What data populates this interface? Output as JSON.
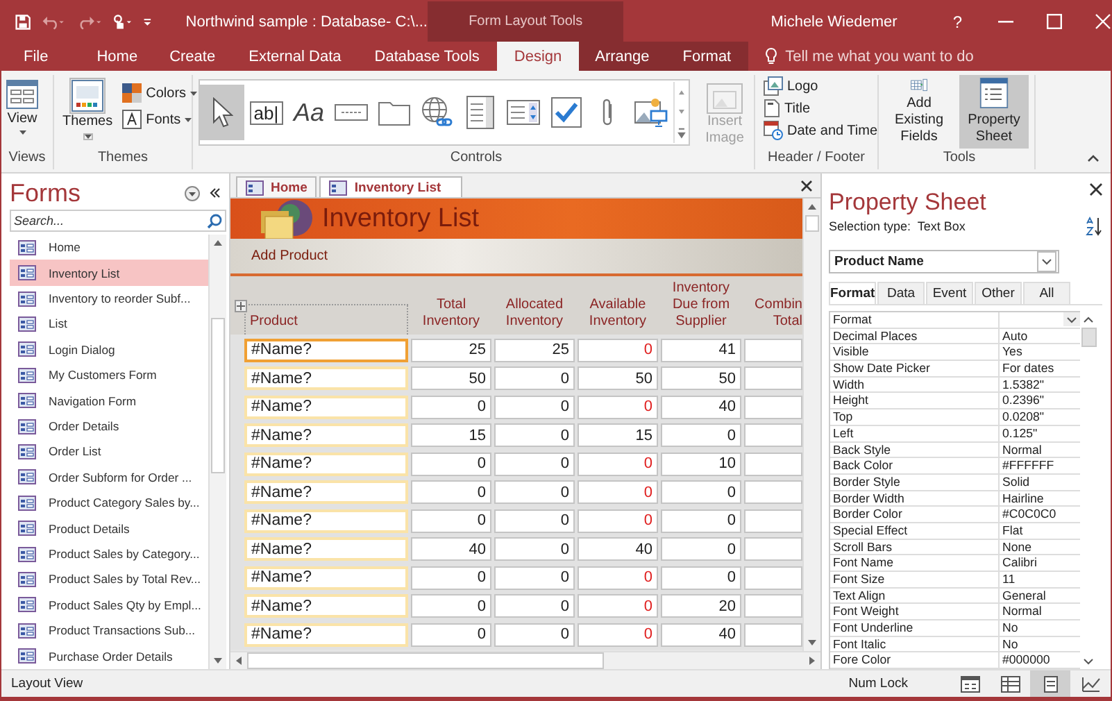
{
  "title_bar": {
    "title": "Northwind sample : Database- C:\\...",
    "context_label": "Form Layout Tools",
    "user": "Michele Wiedemer",
    "help": "?"
  },
  "ribbon_tabs": [
    {
      "label": "File",
      "selected": false,
      "contextual": false
    },
    {
      "label": "Home",
      "selected": false,
      "contextual": false
    },
    {
      "label": "Create",
      "selected": false,
      "contextual": false
    },
    {
      "label": "External Data",
      "selected": false,
      "contextual": false
    },
    {
      "label": "Database Tools",
      "selected": false,
      "contextual": false
    },
    {
      "label": "Design",
      "selected": true,
      "contextual": true
    },
    {
      "label": "Arrange",
      "selected": false,
      "contextual": true
    },
    {
      "label": "Format",
      "selected": false,
      "contextual": true
    }
  ],
  "tell_me": {
    "placeholder": "Tell me what you want to do"
  },
  "ribbon": {
    "views": {
      "label": "Views",
      "button": "View"
    },
    "themes": {
      "label": "Themes",
      "button": "Themes",
      "colors": "Colors",
      "fonts": "Fonts"
    },
    "controls": {
      "label": "Controls",
      "tools": [
        {
          "kind": "pointer",
          "selected": true
        },
        {
          "kind": "textbox",
          "glyph": "ab|",
          "selected": false
        },
        {
          "kind": "label",
          "glyph": "Aa",
          "selected": false
        },
        {
          "kind": "button",
          "selected": false
        },
        {
          "kind": "tab",
          "selected": false
        },
        {
          "kind": "hyperlink",
          "selected": false
        },
        {
          "kind": "listbox",
          "selected": false
        },
        {
          "kind": "combobox",
          "selected": false
        },
        {
          "kind": "checkbox",
          "selected": false
        },
        {
          "kind": "attachment",
          "selected": false
        },
        {
          "kind": "image",
          "selected": false
        }
      ],
      "insert_image": {
        "label": "Insert Image",
        "disabled": true
      }
    },
    "header_footer": {
      "label": "Header / Footer",
      "items": [
        {
          "kind": "logo",
          "label": "Logo"
        },
        {
          "kind": "title",
          "label": "Title"
        },
        {
          "kind": "datetime",
          "label": "Date and Time"
        }
      ]
    },
    "tools": {
      "label": "Tools",
      "items": [
        {
          "kind": "fields",
          "label": "Add Existing Fields",
          "selected": false
        },
        {
          "kind": "sheet",
          "label": "Property Sheet",
          "selected": true
        }
      ]
    }
  },
  "nav_pane": {
    "title": "Forms",
    "search": {
      "placeholder": "Search..."
    },
    "items": [
      {
        "label": "Home",
        "selected": false
      },
      {
        "label": "Inventory List",
        "selected": true
      },
      {
        "label": "Inventory to reorder Subf...",
        "selected": false
      },
      {
        "label": "List",
        "selected": false
      },
      {
        "label": "Login Dialog",
        "selected": false
      },
      {
        "label": "My Customers Form",
        "selected": false
      },
      {
        "label": "Navigation Form",
        "selected": false
      },
      {
        "label": "Order Details",
        "selected": false
      },
      {
        "label": "Order List",
        "selected": false
      },
      {
        "label": "Order Subform for Order ...",
        "selected": false
      },
      {
        "label": "Product Category Sales by...",
        "selected": false
      },
      {
        "label": "Product Details",
        "selected": false
      },
      {
        "label": "Product Sales by Category...",
        "selected": false
      },
      {
        "label": "Product Sales by Total Rev...",
        "selected": false
      },
      {
        "label": "Product Sales Qty by Empl...",
        "selected": false
      },
      {
        "label": "Product Transactions Sub...",
        "selected": false
      },
      {
        "label": "Purchase Order Details",
        "selected": false
      }
    ]
  },
  "document_tabs": [
    {
      "label": "Home",
      "selected": false
    },
    {
      "label": "Inventory List",
      "selected": true
    }
  ],
  "form": {
    "title": "Inventory List",
    "action": "Add Product",
    "columns": [
      "Product",
      "Total Inventory",
      "Allocated Inventory",
      "Available Inventory",
      "Inventory Due from Supplier",
      "Combin Total"
    ],
    "rows": [
      {
        "product": "#Name?",
        "total": "25",
        "allocated": "25",
        "available": "0",
        "available_low": true,
        "due": "41",
        "selected": true
      },
      {
        "product": "#Name?",
        "total": "50",
        "allocated": "0",
        "available": "50",
        "available_low": false,
        "due": "50",
        "selected": false
      },
      {
        "product": "#Name?",
        "total": "0",
        "allocated": "0",
        "available": "0",
        "available_low": true,
        "due": "40",
        "selected": false
      },
      {
        "product": "#Name?",
        "total": "15",
        "allocated": "0",
        "available": "15",
        "available_low": false,
        "due": "0",
        "selected": false
      },
      {
        "product": "#Name?",
        "total": "0",
        "allocated": "0",
        "available": "0",
        "available_low": true,
        "due": "10",
        "selected": false
      },
      {
        "product": "#Name?",
        "total": "0",
        "allocated": "0",
        "available": "0",
        "available_low": true,
        "due": "0",
        "selected": false
      },
      {
        "product": "#Name?",
        "total": "0",
        "allocated": "0",
        "available": "0",
        "available_low": true,
        "due": "0",
        "selected": false
      },
      {
        "product": "#Name?",
        "total": "40",
        "allocated": "0",
        "available": "40",
        "available_low": false,
        "due": "0",
        "selected": false
      },
      {
        "product": "#Name?",
        "total": "0",
        "allocated": "0",
        "available": "0",
        "available_low": true,
        "due": "0",
        "selected": false
      },
      {
        "product": "#Name?",
        "total": "0",
        "allocated": "0",
        "available": "0",
        "available_low": true,
        "due": "20",
        "selected": false
      },
      {
        "product": "#Name?",
        "total": "0",
        "allocated": "0",
        "available": "0",
        "available_low": true,
        "due": "40",
        "selected": false
      }
    ]
  },
  "property_sheet": {
    "title": "Property Sheet",
    "selection_label": "Selection type:",
    "selection_type": "Text Box",
    "object": "Product Name",
    "tabs": [
      {
        "label": "Format",
        "selected": true
      },
      {
        "label": "Data",
        "selected": false
      },
      {
        "label": "Event",
        "selected": false
      },
      {
        "label": "Other",
        "selected": false
      },
      {
        "label": "All",
        "selected": false
      }
    ],
    "properties": [
      {
        "name": "Format",
        "dropdown": true
      },
      {
        "name": "Decimal Places",
        "value": "Auto",
        "dropdown": false
      },
      {
        "name": "Visible",
        "value": "Yes",
        "dropdown": false
      },
      {
        "name": "Show Date Picker",
        "value": "For dates",
        "dropdown": false
      },
      {
        "name": "Width",
        "value": "1.5382\"",
        "dropdown": false
      },
      {
        "name": "Height",
        "value": "0.2396\"",
        "dropdown": false
      },
      {
        "name": "Top",
        "value": "0.0208\"",
        "dropdown": false
      },
      {
        "name": "Left",
        "value": "0.125\"",
        "dropdown": false
      },
      {
        "name": "Back Style",
        "value": "Normal",
        "dropdown": false
      },
      {
        "name": "Back Color",
        "value": "#FFFFFF",
        "dropdown": false
      },
      {
        "name": "Border Style",
        "value": "Solid",
        "dropdown": false
      },
      {
        "name": "Border Width",
        "value": "Hairline",
        "dropdown": false
      },
      {
        "name": "Border Color",
        "value": "#C0C0C0",
        "dropdown": false
      },
      {
        "name": "Special Effect",
        "value": "Flat",
        "dropdown": false
      },
      {
        "name": "Scroll Bars",
        "value": "None",
        "dropdown": false
      },
      {
        "name": "Font Name",
        "value": "Calibri",
        "dropdown": false
      },
      {
        "name": "Font Size",
        "value": "11",
        "dropdown": false
      },
      {
        "name": "Text Align",
        "value": "General",
        "dropdown": false
      },
      {
        "name": "Font Weight",
        "value": "Normal",
        "dropdown": false
      },
      {
        "name": "Font Underline",
        "value": "No",
        "dropdown": false
      },
      {
        "name": "Font Italic",
        "value": "No",
        "dropdown": false
      },
      {
        "name": "Fore Color",
        "value": "#000000",
        "dropdown": false
      }
    ]
  },
  "status_bar": {
    "mode": "Layout View",
    "indicator": "Num Lock",
    "views": [
      {
        "kind": "form",
        "selected": false
      },
      {
        "kind": "datasheet",
        "selected": false
      },
      {
        "kind": "layout",
        "selected": true
      },
      {
        "kind": "design",
        "selected": false
      }
    ]
  }
}
